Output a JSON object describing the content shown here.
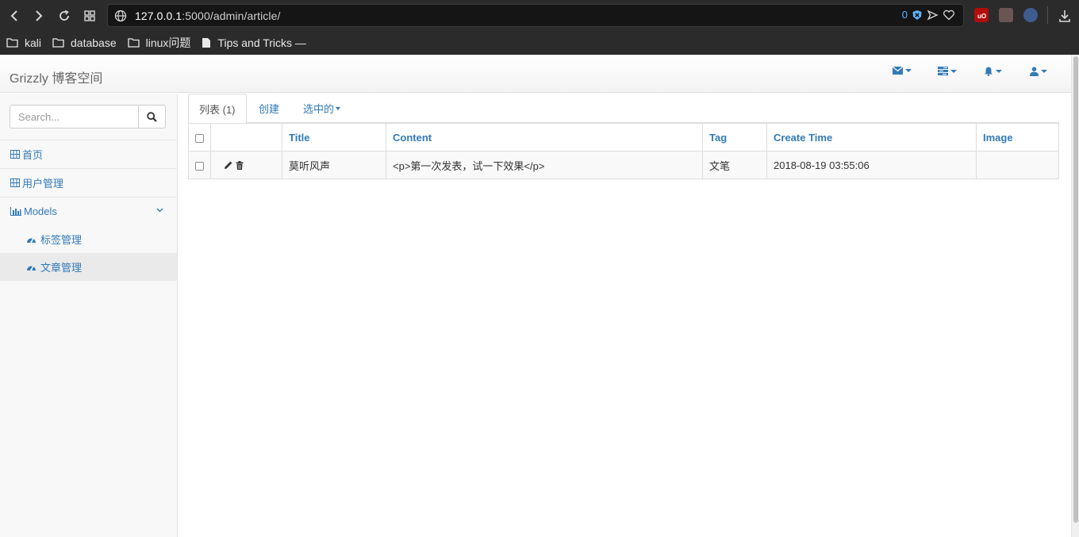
{
  "browser": {
    "url_host": "127.0.0.1",
    "url_path": ":5000/admin/article/",
    "counter": "0",
    "bookmarks": [
      {
        "label": "kali",
        "icon": "folder-icon"
      },
      {
        "label": "database",
        "icon": "folder-icon"
      },
      {
        "label": "linux问题",
        "icon": "folder-icon"
      },
      {
        "label": "Tips and Tricks —",
        "icon": "page-icon"
      }
    ]
  },
  "navbar": {
    "brand": "Grizzly 博客空间",
    "icons": [
      "envelope-icon",
      "tasks-icon",
      "bell-icon",
      "user-icon"
    ]
  },
  "sidebar": {
    "search_placeholder": "Search...",
    "items": [
      {
        "label": "首页",
        "icon": "grid-icon"
      },
      {
        "label": "用户管理",
        "icon": "grid-icon"
      },
      {
        "label": "Models",
        "icon": "bar-chart-icon"
      }
    ],
    "subitems": [
      {
        "label": "标签管理",
        "icon": "dashboard-icon"
      },
      {
        "label": "文章管理",
        "icon": "dashboard-icon",
        "active": true
      }
    ]
  },
  "tabs": {
    "list": "列表 (1)",
    "create": "创建",
    "selected": "选中的"
  },
  "table": {
    "columns": [
      "Title",
      "Content",
      "Tag",
      "Create Time",
      "Image"
    ],
    "rows": [
      {
        "title": "莫听风声",
        "content": "<p>第一次发表，试一下效果</p>",
        "tag": "文笔",
        "create_time": "2018-08-19 03:55:06",
        "image": ""
      }
    ]
  }
}
